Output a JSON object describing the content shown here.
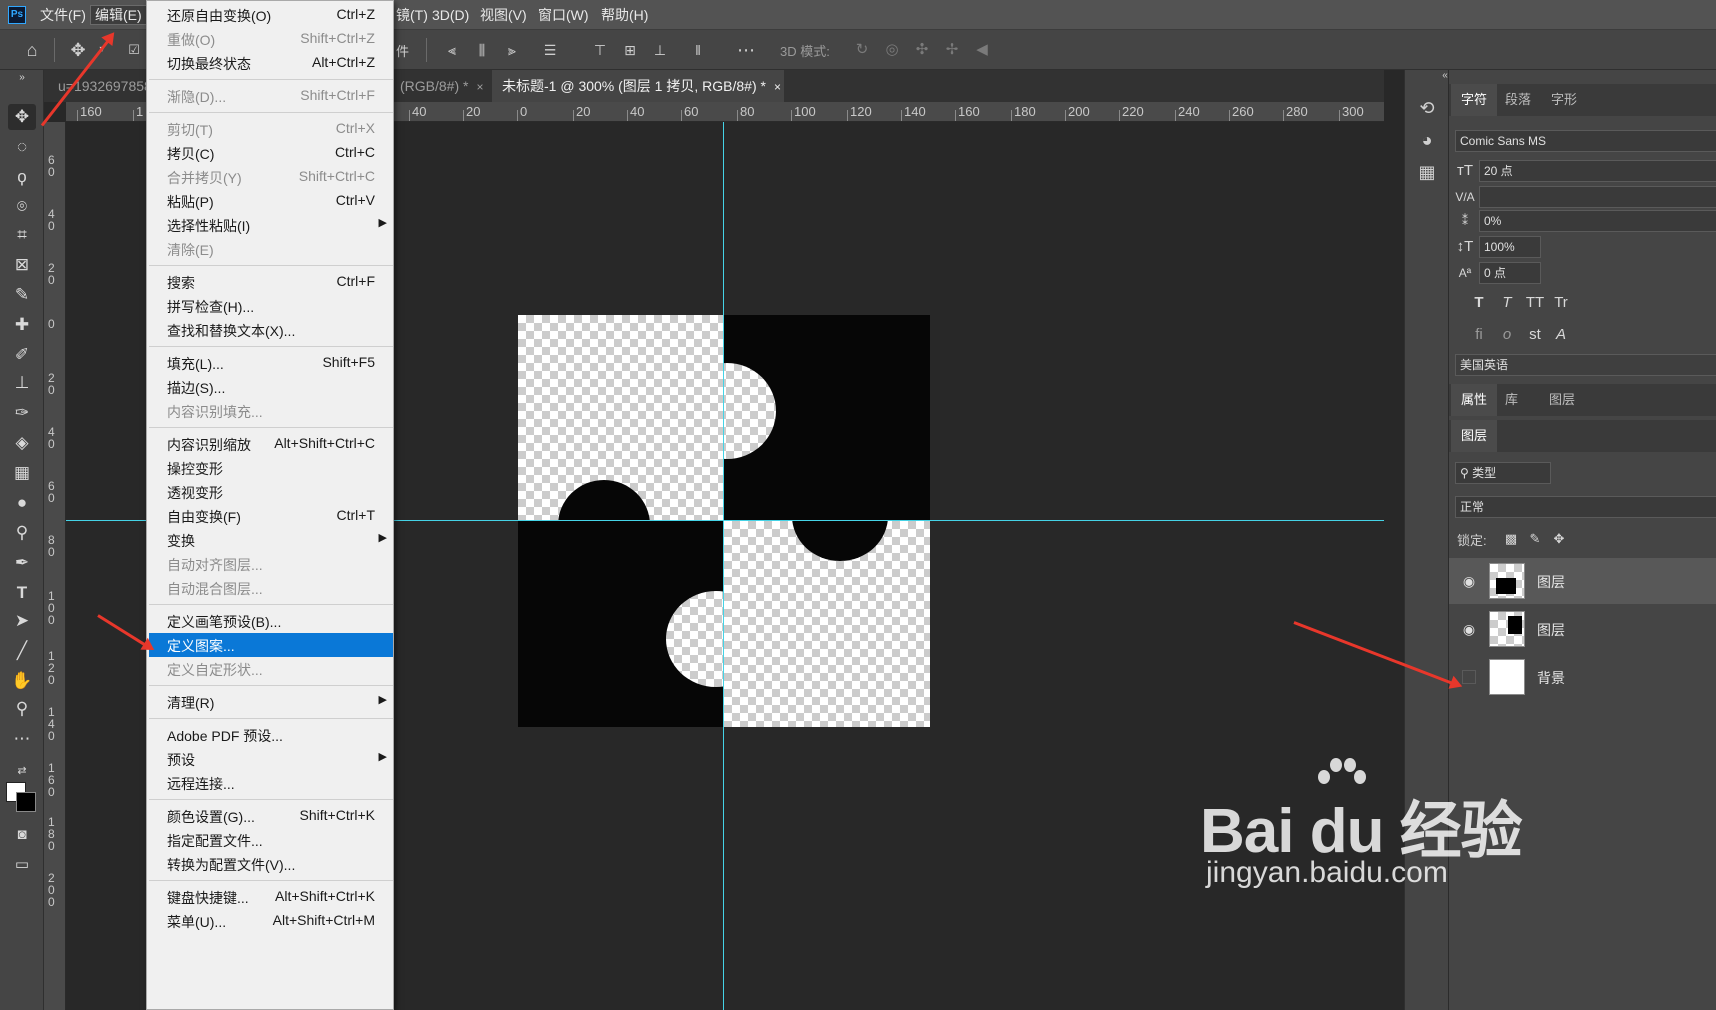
{
  "menubar": {
    "app_icon": "Ps",
    "items": [
      "文件(F)",
      "编辑(E)",
      "镜(T)",
      "3D(D)",
      "视图(V)",
      "窗口(W)",
      "帮助(H)"
    ]
  },
  "options": {
    "partial_label": "件",
    "mode_3d": "3D 模式:"
  },
  "tabs": [
    {
      "label": "u=1932697858"
    },
    {
      "label": "(RGB/8#) *",
      "close": "×"
    },
    {
      "label": "未标题-1 @ 300% (图层 1 拷贝, RGB/8#) *",
      "close": "×"
    }
  ],
  "ruler_h": [
    "160",
    "1",
    "40",
    "20",
    "0",
    "20",
    "40",
    "60",
    "80",
    "100",
    "120",
    "140",
    "160",
    "180",
    "200",
    "220",
    "240",
    "260",
    "280",
    "300"
  ],
  "ruler_v": [
    "6 0",
    "4 0",
    "2 0",
    "0",
    "2 0",
    "4 0",
    "6 0",
    "8 0",
    "1 0 0",
    "1 2 0",
    "1 4 0",
    "1 6 0",
    "1 8 0",
    "2 0 0"
  ],
  "edit_menu": {
    "items": [
      {
        "label": "还原自由变换(O)",
        "shortcut": "Ctrl+Z",
        "enabled": true
      },
      {
        "label": "重做(O)",
        "shortcut": "Shift+Ctrl+Z",
        "enabled": false
      },
      {
        "label": "切换最终状态",
        "shortcut": "Alt+Ctrl+Z",
        "enabled": true
      },
      {
        "label": "渐隐(D)...",
        "shortcut": "Shift+Ctrl+F",
        "enabled": false
      },
      {
        "label": "剪切(T)",
        "shortcut": "Ctrl+X",
        "enabled": false
      },
      {
        "label": "拷贝(C)",
        "shortcut": "Ctrl+C",
        "enabled": true
      },
      {
        "label": "合并拷贝(Y)",
        "shortcut": "Shift+Ctrl+C",
        "enabled": false
      },
      {
        "label": "粘贴(P)",
        "shortcut": "Ctrl+V",
        "enabled": true
      },
      {
        "label": "选择性粘贴(I)",
        "shortcut": "",
        "enabled": true
      },
      {
        "label": "清除(E)",
        "shortcut": "",
        "enabled": false
      },
      {
        "label": "搜索",
        "shortcut": "Ctrl+F",
        "enabled": true
      },
      {
        "label": "拼写检查(H)...",
        "shortcut": "",
        "enabled": true
      },
      {
        "label": "查找和替换文本(X)...",
        "shortcut": "",
        "enabled": true
      },
      {
        "label": "填充(L)...",
        "shortcut": "Shift+F5",
        "enabled": true
      },
      {
        "label": "描边(S)...",
        "shortcut": "",
        "enabled": true
      },
      {
        "label": "内容识别填充...",
        "shortcut": "",
        "enabled": false
      },
      {
        "label": "内容识别缩放",
        "shortcut": "Alt+Shift+Ctrl+C",
        "enabled": true
      },
      {
        "label": "操控变形",
        "shortcut": "",
        "enabled": true
      },
      {
        "label": "透视变形",
        "shortcut": "",
        "enabled": true
      },
      {
        "label": "自由变换(F)",
        "shortcut": "Ctrl+T",
        "enabled": true
      },
      {
        "label": "变换",
        "shortcut": "",
        "enabled": true
      },
      {
        "label": "自动对齐图层...",
        "shortcut": "",
        "enabled": false
      },
      {
        "label": "自动混合图层...",
        "shortcut": "",
        "enabled": false
      },
      {
        "label": "定义画笔预设(B)...",
        "shortcut": "",
        "enabled": true
      },
      {
        "label": "定义图案...",
        "shortcut": "",
        "enabled": true
      },
      {
        "label": "定义自定形状...",
        "shortcut": "",
        "enabled": false
      },
      {
        "label": "清理(R)",
        "shortcut": "",
        "enabled": true
      },
      {
        "label": "Adobe PDF 预设...",
        "shortcut": "",
        "enabled": true
      },
      {
        "label": "预设",
        "shortcut": "",
        "enabled": true
      },
      {
        "label": "远程连接...",
        "shortcut": "",
        "enabled": true
      },
      {
        "label": "颜色设置(G)...",
        "shortcut": "Shift+Ctrl+K",
        "enabled": true
      },
      {
        "label": "指定配置文件...",
        "shortcut": "",
        "enabled": true
      },
      {
        "label": "转换为配置文件(V)...",
        "shortcut": "",
        "enabled": true
      },
      {
        "label": "键盘快捷键...",
        "shortcut": "Alt+Shift+Ctrl+K",
        "enabled": true
      },
      {
        "label": "菜单(U)...",
        "shortcut": "Alt+Shift+Ctrl+M",
        "enabled": true
      }
    ],
    "highlighted": "定义图案...",
    "submenu_arrow": "▶"
  },
  "character_panel": {
    "tabs": [
      "字符",
      "段落",
      "字形"
    ],
    "font": "Comic Sans MS",
    "size": "20 点",
    "tracking": "0%",
    "vscale": "100%",
    "baseline": "0 点",
    "language": "美国英语",
    "style_buttons": [
      "T",
      "T",
      "TT",
      "Tr"
    ],
    "ot_buttons": [
      "fi",
      "o",
      "st",
      "A"
    ]
  },
  "properties_tabs": [
    "属性",
    "库",
    "图层"
  ],
  "layers_panel": {
    "tab": "图层",
    "filter": "类型",
    "blend_mode": "正常",
    "lock_label": "锁定:",
    "layers": [
      {
        "name": "图层",
        "visible": true
      },
      {
        "name": "图层",
        "visible": true
      },
      {
        "name": "背景",
        "visible": false
      }
    ]
  },
  "watermark": {
    "brand": "Bai du 经验",
    "url": "jingyan.baidu.com"
  },
  "colors": {
    "accent_highlight": "#0a78d7",
    "guide": "#45d3e6",
    "arrow": "#e8372b"
  }
}
